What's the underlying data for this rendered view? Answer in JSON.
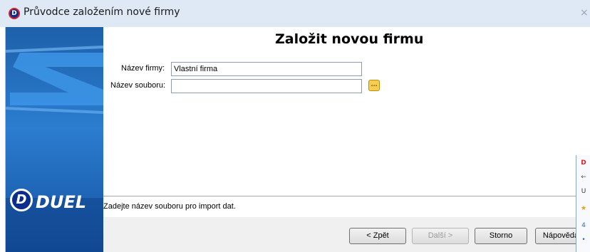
{
  "window": {
    "title": "Průvodce založením nové firmy",
    "close_glyph": "×"
  },
  "logo": {
    "letter": "D",
    "brand": "DUEL"
  },
  "page": {
    "title": "Založit novou firmu"
  },
  "form": {
    "company_label": "Název firmy:",
    "company_value": "Vlastní firma",
    "file_label": "Název souboru:",
    "file_value": "",
    "browse_label": "..."
  },
  "status": {
    "text": "Zadejte název souboru pro import dat."
  },
  "buttons": {
    "back": "< Zpět",
    "next": "Další >",
    "cancel": "Storno",
    "help": "Nápověda"
  },
  "popup": {
    "items": [
      "D",
      "←",
      "U",
      "★",
      "4",
      "•"
    ]
  },
  "colors": {
    "sidebar_top": "#1d61a9",
    "sidebar_bottom": "#1550a0",
    "brand_red": "#d81e2a",
    "brand_navy": "#0b2e8c",
    "browse_yellow": "#f6cd4f"
  },
  "icons": {
    "app": "duel-logo-icon",
    "browse": "folder-browse-icon",
    "close": "close-icon"
  }
}
